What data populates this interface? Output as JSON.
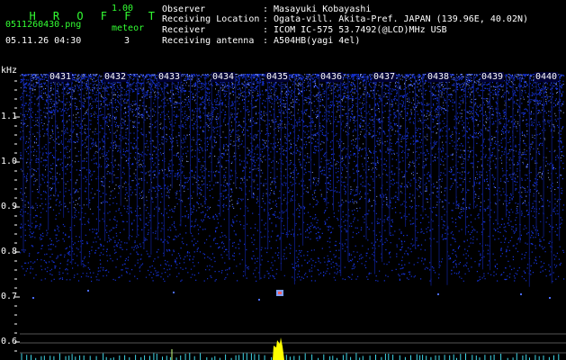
{
  "header": {
    "app_name": "H R O F F T",
    "version": "1.00",
    "file_name": "0511260430.png",
    "datetime": "05.11.26 04:30",
    "meteor_label": "meteor",
    "meteor_count": "3",
    "info": [
      {
        "label": "Observer",
        "value": ": Masayuki Kobayashi"
      },
      {
        "label": "Receiving Location",
        "value": ": Ogata-vill. Akita-Pref. JAPAN (139.96E, 40.02N)"
      },
      {
        "label": "Receiver",
        "value": ": ICOM IC-575 53.7492(@LCD)MHz USB"
      },
      {
        "label": "Receiving antenna",
        "value": ": A504HB(yagi 4el)"
      }
    ]
  },
  "spectrogram": {
    "y_unit": "kHz",
    "y_ticks": [
      "1.1",
      "1.0",
      "0.9",
      "0.8",
      "0.7",
      "0.6"
    ],
    "time_labels": [
      "0431",
      "0432",
      "0433",
      "0434",
      "0435",
      "0436",
      "0437",
      "0438",
      "0439",
      "0440"
    ],
    "colors": {
      "background": "#000000",
      "noise": "#1a3cff",
      "grid": "#555555",
      "header_green": "#33ff33",
      "meteor_echo": "#ffff00"
    }
  }
}
